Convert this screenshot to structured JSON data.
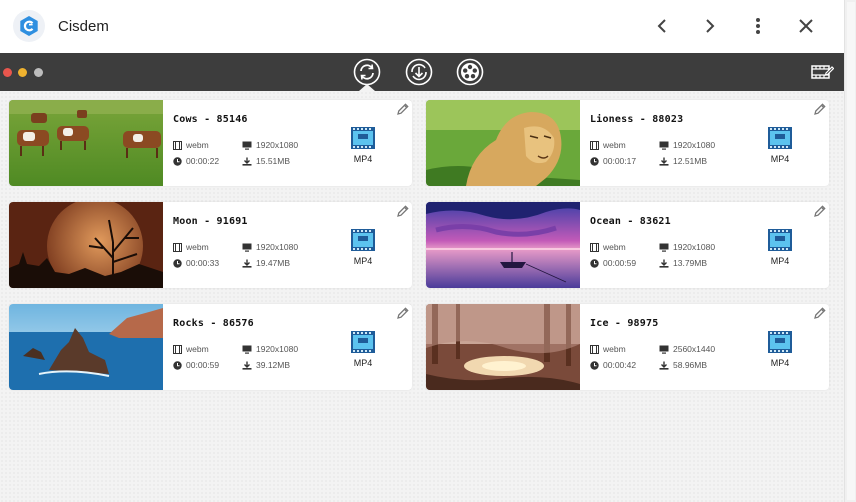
{
  "app": {
    "title": "Cisdem",
    "logo_icon": "cisdem-logo-icon"
  },
  "nav": {
    "back_icon": "chevron-left-icon",
    "forward_icon": "chevron-right-icon",
    "menu_icon": "more-vertical-icon",
    "close_icon": "close-icon"
  },
  "toolbar": {
    "modes": [
      "convert-icon",
      "download-icon",
      "dvd-icon"
    ],
    "active_mode": 0,
    "right_icon": "film-edit-icon",
    "window_dots": [
      "#e8564d",
      "#efb22f",
      "#bdbdbd"
    ]
  },
  "videos": [
    {
      "title": "Cows - 85146",
      "format": "webm",
      "resolution": "1920x1080",
      "duration": "00:00:22",
      "size": "15.51MB",
      "output": "MP4",
      "thumb": "cows"
    },
    {
      "title": "Lioness - 88023",
      "format": "webm",
      "resolution": "1920x1080",
      "duration": "00:00:17",
      "size": "12.51MB",
      "output": "MP4",
      "thumb": "lioness"
    },
    {
      "title": "Moon - 91691",
      "format": "webm",
      "resolution": "1920x1080",
      "duration": "00:00:33",
      "size": "19.47MB",
      "output": "MP4",
      "thumb": "moon"
    },
    {
      "title": "Ocean - 83621",
      "format": "webm",
      "resolution": "1920x1080",
      "duration": "00:00:59",
      "size": "13.79MB",
      "output": "MP4",
      "thumb": "ocean"
    },
    {
      "title": "Rocks - 86576",
      "format": "webm",
      "resolution": "1920x1080",
      "duration": "00:00:59",
      "size": "39.12MB",
      "output": "MP4",
      "thumb": "rocks"
    },
    {
      "title": "Ice - 98975",
      "format": "webm",
      "resolution": "2560x1440",
      "duration": "00:00:42",
      "size": "58.96MB",
      "output": "MP4",
      "thumb": "ice"
    }
  ]
}
